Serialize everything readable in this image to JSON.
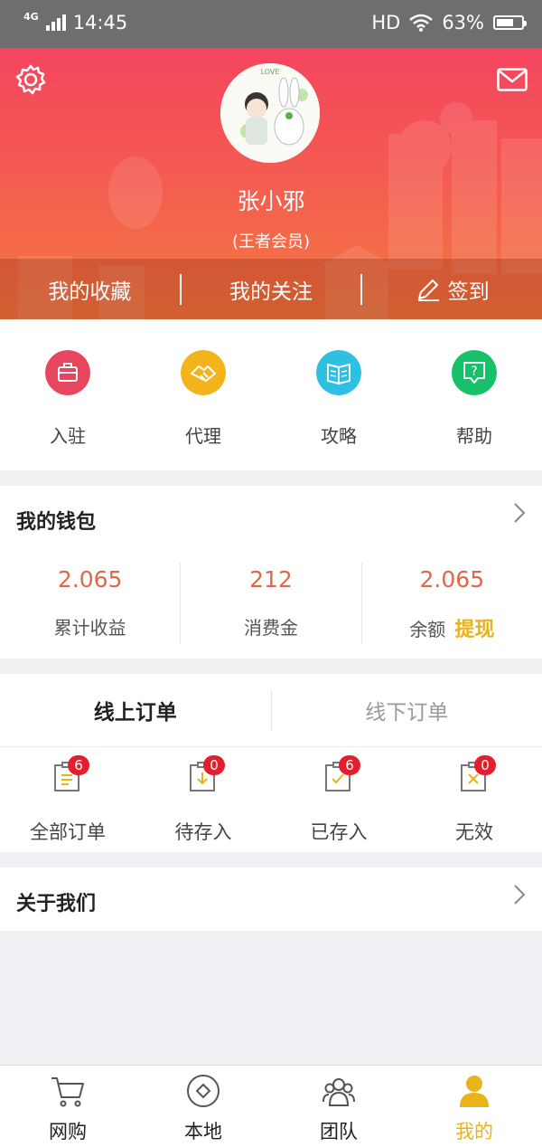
{
  "status_bar": {
    "network": "4G",
    "time": "14:45",
    "hd": "HD",
    "battery": "63%"
  },
  "profile": {
    "name": "张小邪",
    "level": "(王者会员)"
  },
  "header_actions": {
    "favorites": "我的收藏",
    "follows": "我的关注",
    "checkin": "签到"
  },
  "quick_menu": [
    {
      "label": "入驻",
      "color": "#e8455e",
      "icon": "briefcase-icon"
    },
    {
      "label": "代理",
      "color": "#f2b31b",
      "icon": "handshake-icon"
    },
    {
      "label": "攻略",
      "color": "#2ec0e3",
      "icon": "book-icon"
    },
    {
      "label": "帮助",
      "color": "#19c06a",
      "icon": "help-chat-icon"
    }
  ],
  "wallet": {
    "title": "我的钱包",
    "items": [
      {
        "value": "2.065",
        "label": "累计收益"
      },
      {
        "value": "212",
        "label": "消费金"
      },
      {
        "value": "2.065",
        "label": "余额"
      }
    ],
    "withdraw": "提现"
  },
  "orders": {
    "tabs": [
      "线上订单",
      "线下订单"
    ],
    "categories": [
      {
        "label": "全部订单",
        "badge": "6"
      },
      {
        "label": "待存入",
        "badge": "0"
      },
      {
        "label": "已存入",
        "badge": "6"
      },
      {
        "label": "无效",
        "badge": "0"
      }
    ]
  },
  "about": {
    "title": "关于我们"
  },
  "tab_bar": [
    {
      "label": "网购",
      "icon": "cart-icon"
    },
    {
      "label": "本地",
      "icon": "local-icon"
    },
    {
      "label": "团队",
      "icon": "team-icon"
    },
    {
      "label": "我的",
      "icon": "profile-icon"
    }
  ],
  "colors": {
    "accent": "#e8b41a",
    "number": "#e0684a",
    "badge": "#e41f2d"
  }
}
